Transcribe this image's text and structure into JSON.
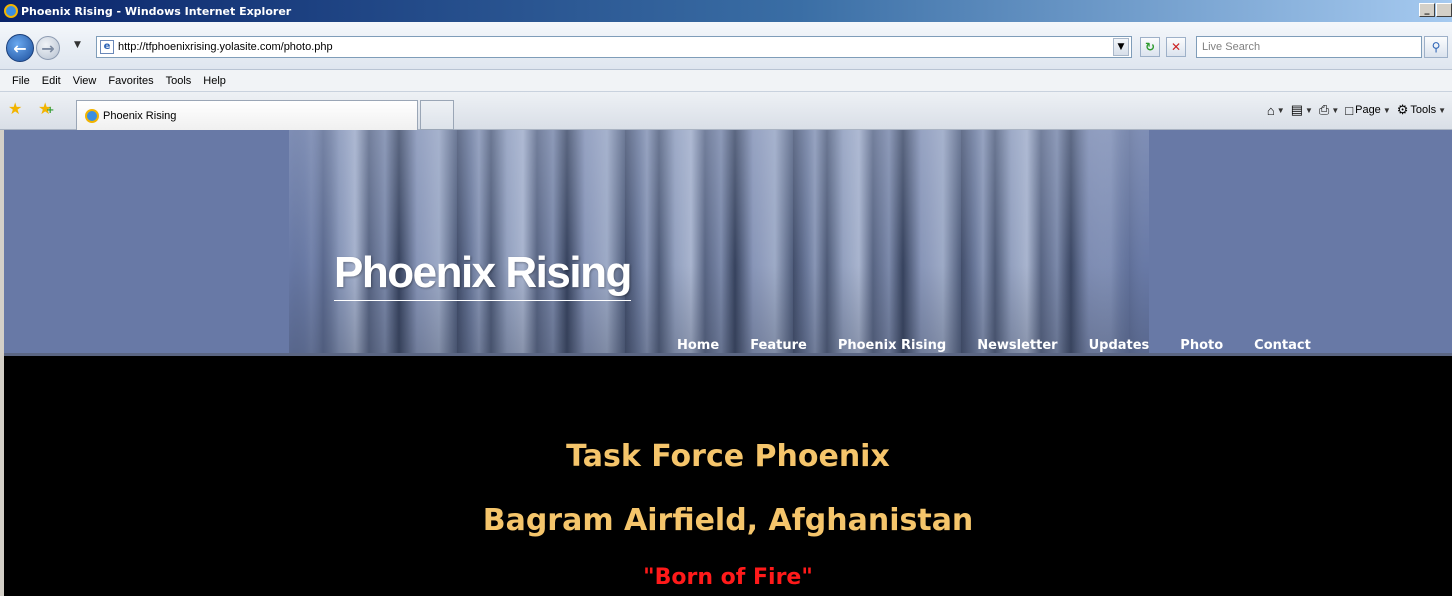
{
  "window": {
    "title": "Phoenix Rising - Windows Internet Explorer",
    "minimize_label": "_",
    "maximize_label": " "
  },
  "address_bar": {
    "url": "http://tfphoenixrising.yolasite.com/photo.php",
    "search_placeholder": "Live Search"
  },
  "menu": {
    "items": [
      "File",
      "Edit",
      "View",
      "Favorites",
      "Tools",
      "Help"
    ]
  },
  "tabs": {
    "active_title": "Phoenix Rising"
  },
  "command_bar": {
    "page_label": "Page",
    "tools_label": "Tools"
  },
  "site": {
    "title": "Phoenix Rising",
    "nav": [
      "Home",
      "Feature",
      "Phoenix Rising",
      "Newsletter",
      "Updates",
      "Photo",
      "Contact"
    ]
  },
  "content": {
    "heading1": "Task Force Phoenix",
    "heading2": "Bagram Airfield, Afghanistan",
    "heading3": "\"Born of Fire\""
  },
  "colors": {
    "header_bg": "#6879a6",
    "heading_gold": "#f5c56b",
    "heading_red": "#ff1a1a"
  }
}
